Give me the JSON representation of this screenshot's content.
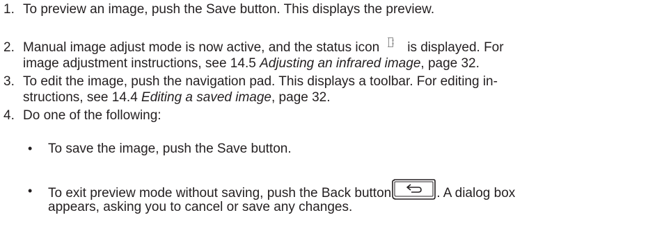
{
  "steps": [
    {
      "num": "1.",
      "text": "To preview an image, push the Save button. This displays the preview."
    },
    {
      "num": "2.",
      "text_a": "Manual image adjust mode is now active, and the status icon",
      "text_b": "is displayed. For",
      "text_c": "image adjustment instructions, see 14.5 ",
      "ref_title": "Adjusting an infrared image",
      "text_d": ", page 32."
    },
    {
      "num": "3.",
      "text_a": "To edit the image, push the navigation pad. This displays a toolbar. For editing in-",
      "text_b": "structions, see 14.4 ",
      "ref_title": "Editing a saved image",
      "text_c": ", page 32."
    },
    {
      "num": "4.",
      "text": "Do one of the following:",
      "options": [
        {
          "text": "To save the image, push the Save button."
        },
        {
          "text_a": "To exit preview mode without saving, push the Back button",
          "text_b": ". A dialog box",
          "text_c": "appears, asking you to cancel or save any changes."
        }
      ]
    }
  ],
  "bullet_char": "•",
  "icons": {
    "status": "manual-adjust-status-icon",
    "back": "back-button-icon"
  }
}
